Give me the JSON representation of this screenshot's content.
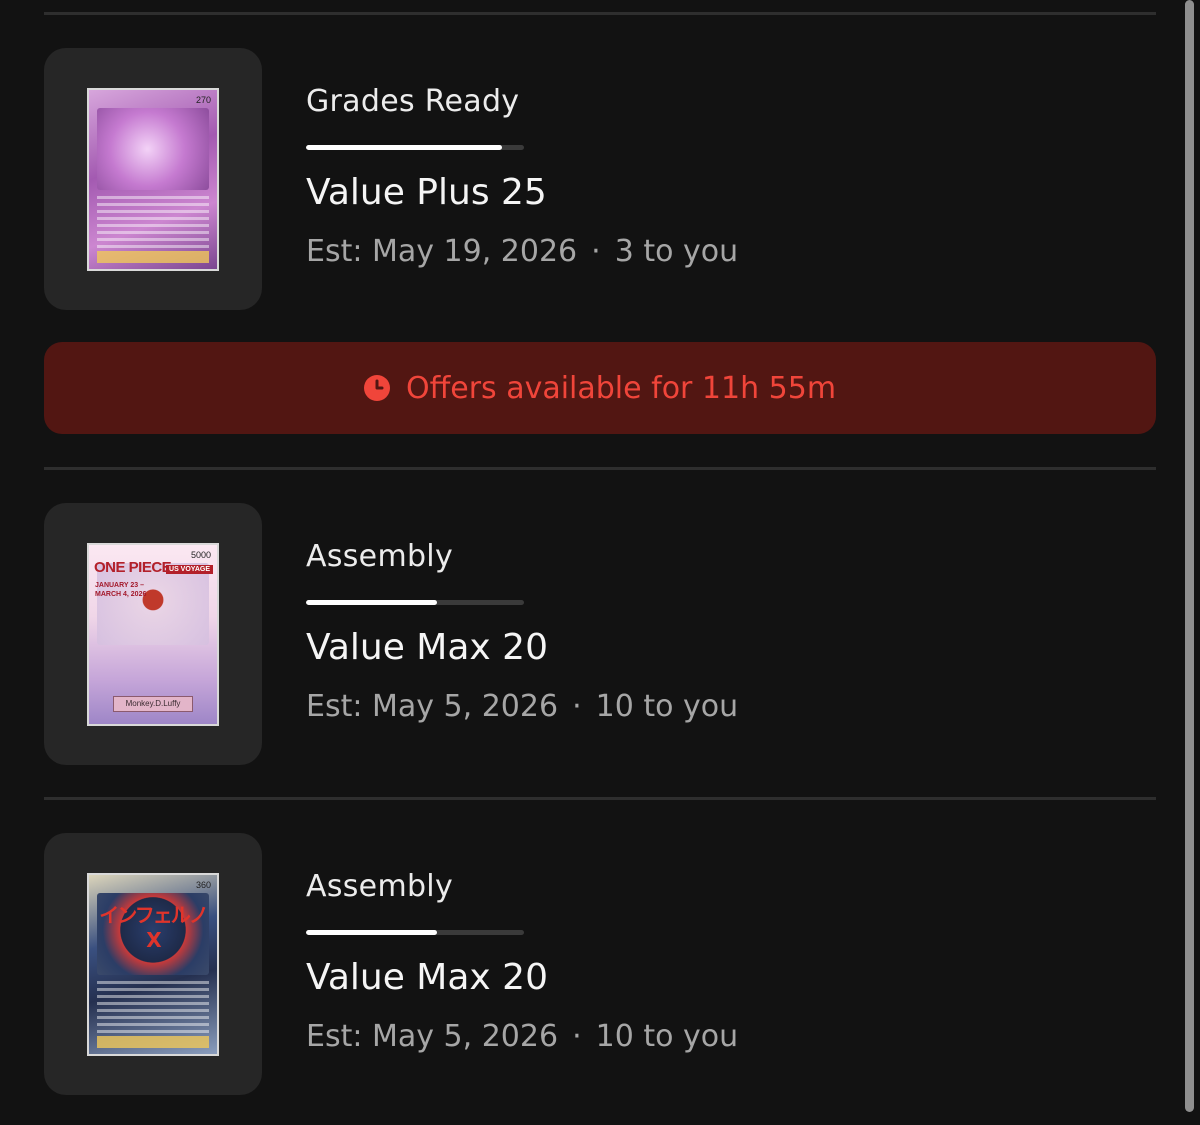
{
  "orders": [
    {
      "status": "Grades Ready",
      "progress": 0.9,
      "service": "Value Plus 25",
      "est": "Est: May 19, 2026",
      "separator": "·",
      "to_you": "3 to you",
      "card": {
        "hp": "270",
        "icon": "pokemon-card-image"
      }
    },
    {
      "status": "Assembly",
      "progress": 0.6,
      "service": "Value Max 20",
      "est": "Est: May 5, 2026",
      "separator": "·",
      "to_you": "10 to you",
      "card": {
        "logo": "ONE PIECE",
        "tag": "US VOYAGE",
        "date_line1": "JANUARY 23 –",
        "date_line2": "MARCH 4, 2026",
        "name": "Monkey.D.Luffy",
        "power": "5000",
        "icon": "one-piece-card-image"
      }
    },
    {
      "status": "Assembly",
      "progress": 0.6,
      "service": "Value Max 20",
      "est": "Est: May 5, 2026",
      "separator": "·",
      "to_you": "10 to you",
      "card": {
        "hp": "360",
        "title": "インフェルノX",
        "icon": "charizard-card-image"
      }
    }
  ],
  "offers_banner": {
    "text": "Offers available for 11h 55m",
    "icon": "clock-icon",
    "color": "#f0453a",
    "background": "#521612"
  },
  "colors": {
    "background": "#121212",
    "thumb": "#262626",
    "divider": "#2e2e2e"
  }
}
